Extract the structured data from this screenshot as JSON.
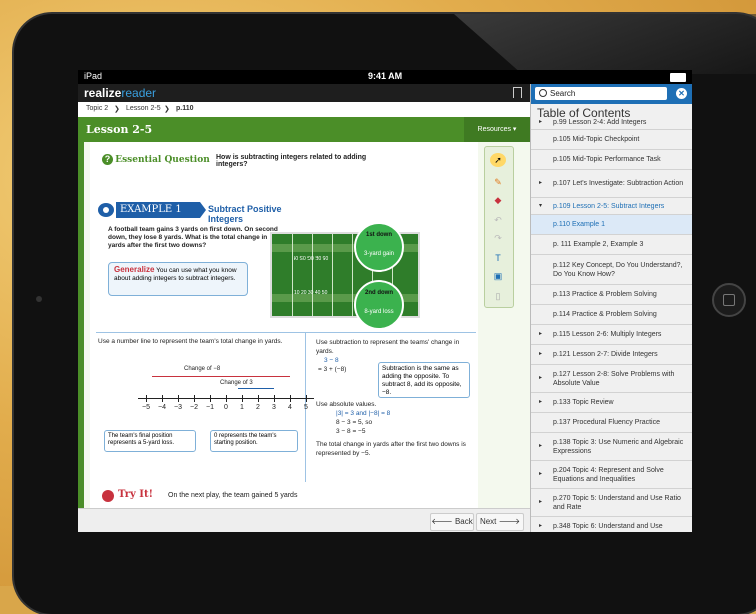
{
  "status": {
    "device": "iPad",
    "time": "9:41 AM"
  },
  "app": {
    "logo_main": "realize",
    "logo_sub": "reader"
  },
  "breadcrumb": [
    "Topic 2",
    "Lesson 2-5",
    "p.110"
  ],
  "breadcrumb_sep": "❯",
  "lesson": {
    "title": "Lesson 2-5",
    "resources": "Resources ▾"
  },
  "essential": {
    "label": "Essential Question",
    "text": "How is subtracting integers related to adding integers?"
  },
  "example": {
    "tab": "EXAMPLE 1",
    "title": "Subtract Positive Integers"
  },
  "problem": "A football team gains 3 yards on first down. On second down, they lose 8 yards. What is the total change in yards after the first two downs?",
  "generalize": {
    "label": "Generalize",
    "text": "You can use what you know about adding integers to subtract integers."
  },
  "field": {
    "first_down": {
      "title": "1st down",
      "sub": "3-yard gain"
    },
    "second_down": {
      "title": "2nd down",
      "sub": "8-yard loss"
    },
    "yard_top": "05 0E 0G 0S 0f",
    "yard_bottom": "10 20 30 40 50"
  },
  "left_col": {
    "intro": "Use a number line to represent the team's total change in yards.",
    "change_neg8": "Change of −8",
    "change_3": "Change of 3",
    "ticks": [
      "−5",
      "−4",
      "−3",
      "−2",
      "−1",
      "0",
      "1",
      "2",
      "3",
      "4",
      "5"
    ],
    "note_left": "The team's final position represents a 5-yard loss.",
    "note_right": "0 represents the team's starting position."
  },
  "right_col": {
    "intro": "Use subtraction to represent the teams' change in yards.",
    "l1": "3 − 8",
    "l2": "= 3 + (−8)",
    "callout": "Subtraction is the same as adding the opposite. To subtract 8, add its opposite, −8.",
    "abs_intro": "Use absolute values.",
    "abs1": "|3| = 3 and |−8| = 8",
    "abs2": "8 − 3 = 5, so",
    "abs3": "3 − 8 = −5",
    "conclusion": "The total change in yards after the first two downs is represented by −5."
  },
  "tryit": {
    "label": "Try It!",
    "text": "On the next play, the team gained 5 yards"
  },
  "nav": {
    "back": "🡐 Back",
    "next": "Next 🡒"
  },
  "toc": {
    "search_placeholder": "Search",
    "heading": "Table of Contents",
    "items": [
      {
        "label": "p.99 Lesson 2-4: Add Integers",
        "arrow": "▸",
        "h": 14
      },
      {
        "label": "p.105 Mid-Topic Checkpoint",
        "arrow": "",
        "h": 20
      },
      {
        "label": "p.105 Mid-Topic Performance Task",
        "arrow": "",
        "h": 20
      },
      {
        "label": "p.107 Let's Investigate: Subtraction Action",
        "arrow": "▸",
        "h": 28
      },
      {
        "label": "p.109 Lesson 2-5: Subtract Integers",
        "arrow": "▾",
        "h": 17,
        "state": "open"
      },
      {
        "label": "p.110 Example 1",
        "arrow": "",
        "h": 20,
        "state": "selected"
      },
      {
        "label": "p. 111 Example 2, Example 3",
        "arrow": "",
        "h": 20
      },
      {
        "label": "p.112 Key Concept, Do You Understand?, Do You Know How?",
        "arrow": "",
        "h": 30
      },
      {
        "label": "p.113 Practice & Problem Solving",
        "arrow": "",
        "h": 20
      },
      {
        "label": "p.114 Practice & Problem Solving",
        "arrow": "",
        "h": 20
      },
      {
        "label": "p.115 Lesson 2-6: Multiply Integers",
        "arrow": "▸",
        "h": 20
      },
      {
        "label": "p.121 Lesson 2-7: Divide Integers",
        "arrow": "▸",
        "h": 20
      },
      {
        "label": "p.127 Lesson 2-8: Solve Problems with Absolute Value",
        "arrow": "▸",
        "h": 28
      },
      {
        "label": "p.133 Topic Review",
        "arrow": "▸",
        "h": 20
      },
      {
        "label": "p.137 Procedural Fluency Practice",
        "arrow": "",
        "h": 20
      },
      {
        "label": "p.138 Topic 3: Use Numeric and Algebraic Expressions",
        "arrow": "▸",
        "h": 28
      },
      {
        "label": "p.204 Topic 4: Represent and Solve Equations and Inequalities",
        "arrow": "▸",
        "h": 28
      },
      {
        "label": "p.270 Topic 5: Understand and Use Ratio and Rate",
        "arrow": "▸",
        "h": 28
      },
      {
        "label": "p.348 Topic 6: Understand and Use",
        "arrow": "▸",
        "h": 20
      }
    ]
  },
  "colors": {
    "green": "#4b8e28",
    "blue": "#1e6fb5",
    "red": "#c8323e"
  }
}
